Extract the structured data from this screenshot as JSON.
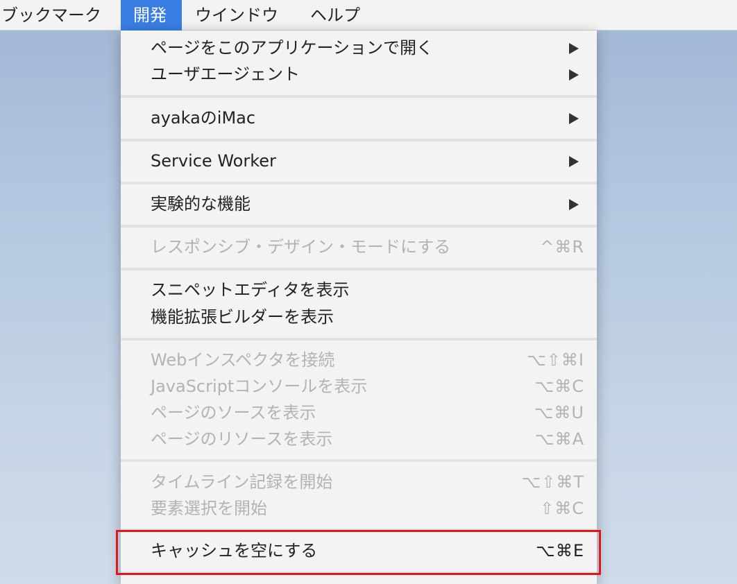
{
  "menubar": {
    "items": [
      {
        "label": "ブックマーク"
      },
      {
        "label": "開発"
      },
      {
        "label": "ウインドウ"
      },
      {
        "label": "ヘルプ"
      }
    ]
  },
  "menu": {
    "items": {
      "open_with_app": {
        "label": "ページをこのアプリケーションで開く"
      },
      "user_agent": {
        "label": "ユーザエージェント"
      },
      "device": {
        "label": "ayakaのiMac"
      },
      "service_worker": {
        "label": "Service Worker"
      },
      "experimental": {
        "label": "実験的な機能"
      },
      "responsive": {
        "label": "レスポンシブ・デザイン・モードにする",
        "shortcut": "^⌘R"
      },
      "snippet_editor": {
        "label": "スニペットエディタを表示"
      },
      "extension_builder": {
        "label": "機能拡張ビルダーを表示"
      },
      "web_inspector": {
        "label": "Webインスペクタを接続",
        "shortcut": "⌥⇧⌘I"
      },
      "js_console": {
        "label": "JavaScriptコンソールを表示",
        "shortcut": "⌥⌘C"
      },
      "page_source": {
        "label": "ページのソースを表示",
        "shortcut": "⌥⌘U"
      },
      "page_resources": {
        "label": "ページのリソースを表示",
        "shortcut": "⌥⌘A"
      },
      "timeline": {
        "label": "タイムライン記録を開始",
        "shortcut": "⌥⇧⌘T"
      },
      "element_select": {
        "label": "要素選択を開始",
        "shortcut": "⇧⌘C"
      },
      "empty_caches": {
        "label": "キャッシュを空にする",
        "shortcut": "⌥⌘E"
      }
    }
  },
  "colors": {
    "menubar_active": "#3a7ee4",
    "highlight_border": "#e5141b",
    "disabled_text": "#b3b3b3"
  }
}
